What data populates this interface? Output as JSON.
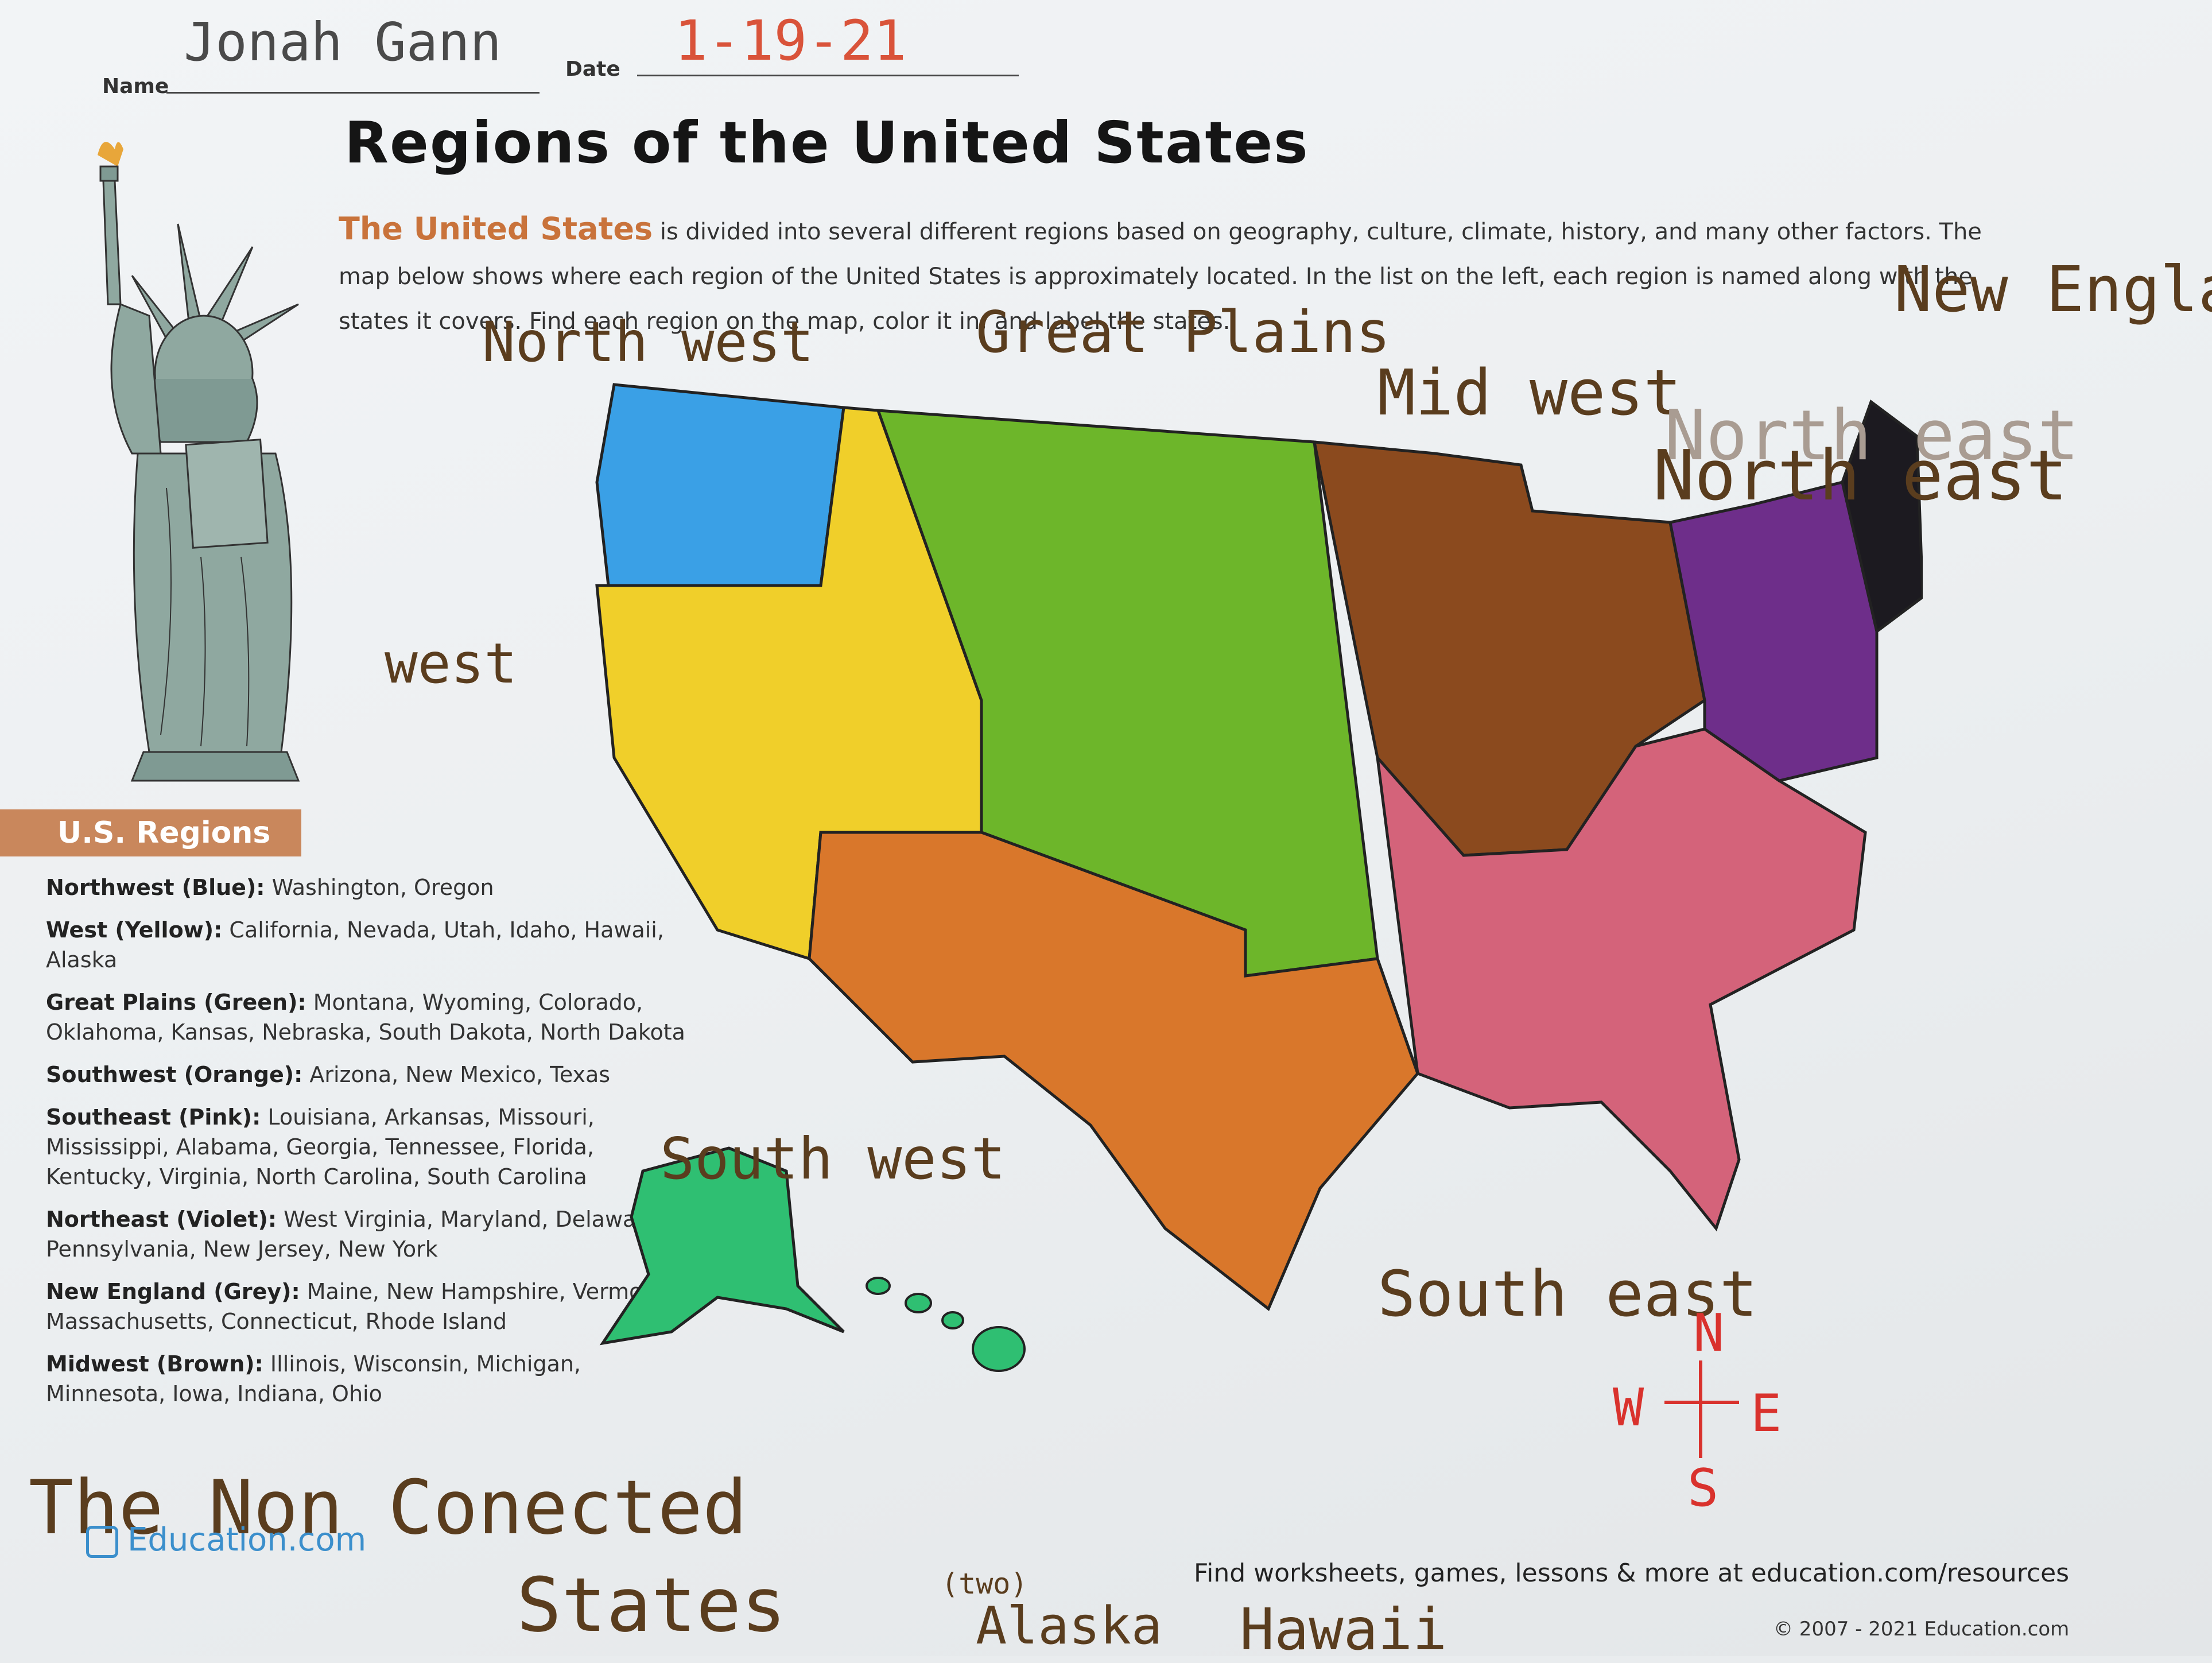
{
  "header": {
    "name_label": "Name",
    "name_value": "Jonah Gann",
    "date_label": "Date",
    "date_value": "1-19-21"
  },
  "title": "Regions of the United States",
  "intro": {
    "lead": "The United States",
    "text": " is divided into several different regions based on geography, culture, climate, history, and many other factors. The map below shows where each region of the United States is approximately located. In the list on the left, each region is named along with the states it covers. Find each region on the map, color it in, and label the states."
  },
  "regions_banner": "U.S. Regions",
  "regions": [
    {
      "name": "Northwest (Blue):",
      "states": " Washington, Oregon"
    },
    {
      "name": "West (Yellow):",
      "states": " California, Nevada, Utah, Idaho, Hawaii, Alaska"
    },
    {
      "name": "Great Plains (Green):",
      "states": " Montana, Wyoming, Colorado, Oklahoma, Kansas, Nebraska, South Dakota, North Dakota"
    },
    {
      "name": "Southwest (Orange):",
      "states": " Arizona, New Mexico, Texas"
    },
    {
      "name": "Southeast (Pink):",
      "states": " Louisiana, Arkansas, Missouri, Mississippi, Alabama, Georgia, Tennessee, Florida, Kentucky, Virginia, North Carolina, South Carolina"
    },
    {
      "name": "Northeast (Violet):",
      "states": " West Virginia, Maryland, Delaware, Pennsylvania, New Jersey, New York"
    },
    {
      "name": "New England (Grey):",
      "states": " Maine, New Hampshire, Vermont, Massachusetts, Connecticut, Rhode Island"
    },
    {
      "name": "Midwest (Brown):",
      "states": " Illinois, Wisconsin, Michigan, Minnesota, Iowa, Indiana, Ohio"
    }
  ],
  "handwritten": {
    "north_west": "North west",
    "west": "west",
    "great_plains": "Great Plains",
    "mid_west": "Mid west",
    "north_east": "North east",
    "north_east_faded": "North east",
    "new_england": "New England",
    "south_west": "South west",
    "south_east": "South east",
    "non_connected": "The Non Conected",
    "states": "States",
    "two": "(two)",
    "alaska": "Alaska",
    "hawaii": "Hawaii"
  },
  "compass": {
    "n": "N",
    "w": "W",
    "e": "E",
    "s": "S"
  },
  "footer": {
    "logo": "Education.com",
    "resources": "Find worksheets, games, lessons & more at education.com/resources",
    "copyright": "© 2007 - 2021 Education.com"
  },
  "colors": {
    "northwest": "#3aa0e6",
    "west": "#f0cf2a",
    "great_plains": "#6db62a",
    "southwest": "#d9772b",
    "southeast": "#d4637a",
    "northeast": "#6e2e8a",
    "new_england": "#1c1a20",
    "midwest": "#8b4a1e",
    "alaska": "#2fbf72",
    "accent": "#c9733b"
  },
  "icons": [
    "statue-of-liberty-icon",
    "education-logo-icon"
  ]
}
